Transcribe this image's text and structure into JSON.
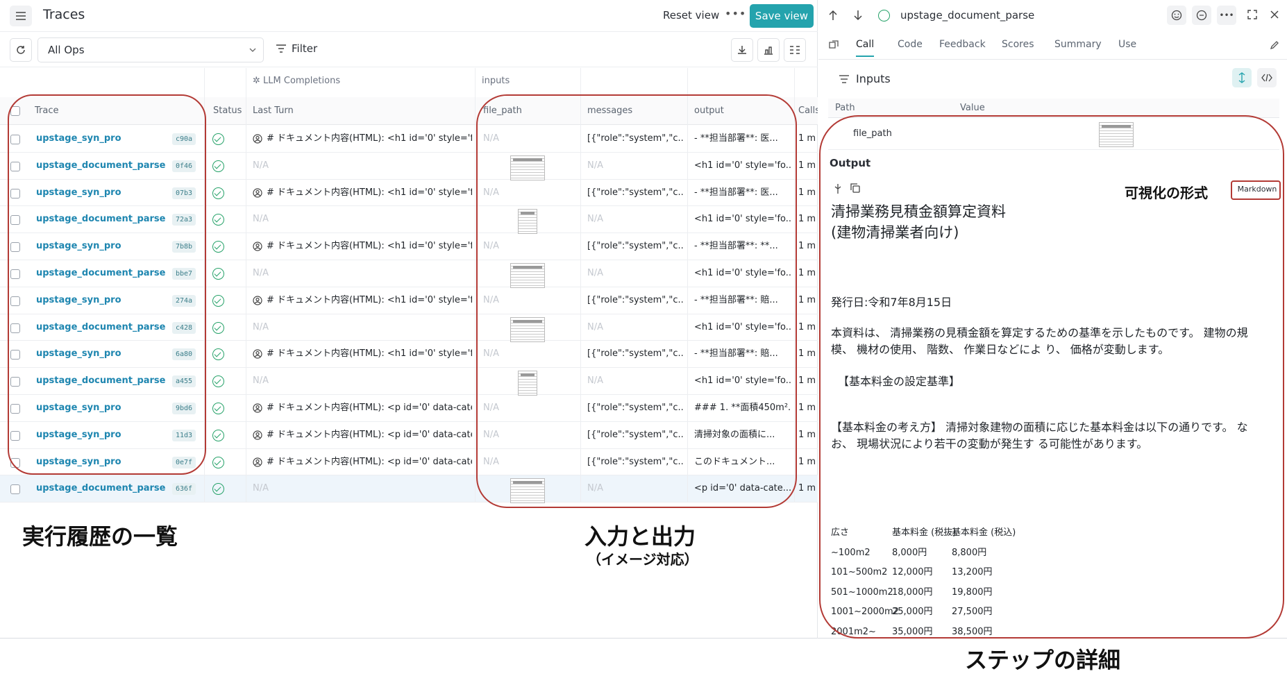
{
  "header": {
    "title": "Traces",
    "reset_view": "Reset view",
    "more": "•••",
    "save_view": "Save view"
  },
  "toolbar": {
    "ops_select": "All Ops",
    "filter": "Filter"
  },
  "table": {
    "group_llm": "LLM Completions",
    "group_inputs": "inputs",
    "columns": {
      "trace": "Trace",
      "status": "Status",
      "last_turn": "Last Turn",
      "file_path": "file_path",
      "messages": "messages",
      "output": "output",
      "calls": "Calls"
    },
    "rows": [
      {
        "name": "upstage_syn_pro",
        "id": "c90a",
        "last_turn": "# ドキュメント内容(HTML): <h1 id='0' style='fo",
        "file_path": "N/A",
        "messages": "[{\"role\":\"system\",\"c...",
        "output": "- **担当部署**: 医...",
        "calls": "1 m"
      },
      {
        "name": "upstage_document_parse",
        "id": "0f46",
        "last_turn": "N/A",
        "file_path": "",
        "messages": "N/A",
        "output": "<h1 id='0' style='fo...",
        "calls": "1 m"
      },
      {
        "name": "upstage_syn_pro",
        "id": "07b3",
        "last_turn": "# ドキュメント内容(HTML): <h1 id='0' style='fo",
        "file_path": "N/A",
        "messages": "[{\"role\":\"system\",\"c...",
        "output": "- **担当部署**: 医...",
        "calls": "1 m"
      },
      {
        "name": "upstage_document_parse",
        "id": "72a3",
        "last_turn": "N/A",
        "file_path": "",
        "messages": "N/A",
        "output": "<h1 id='0' style='fo...",
        "calls": "1 m"
      },
      {
        "name": "upstage_syn_pro",
        "id": "7b8b",
        "last_turn": "# ドキュメント内容(HTML): <h1 id='0' style='fo",
        "file_path": "N/A",
        "messages": "[{\"role\":\"system\",\"c...",
        "output": "- **担当部署**: **...",
        "calls": "1 m"
      },
      {
        "name": "upstage_document_parse",
        "id": "bbe7",
        "last_turn": "N/A",
        "file_path": "",
        "messages": "N/A",
        "output": "<h1 id='0' style='fo...",
        "calls": "1 m"
      },
      {
        "name": "upstage_syn_pro",
        "id": "274a",
        "last_turn": "# ドキュメント内容(HTML): <h1 id='0' style='fo",
        "file_path": "N/A",
        "messages": "[{\"role\":\"system\",\"c...",
        "output": "- **担当部署**: 賠...",
        "calls": "1 m"
      },
      {
        "name": "upstage_document_parse",
        "id": "c428",
        "last_turn": "N/A",
        "file_path": "",
        "messages": "N/A",
        "output": "<h1 id='0' style='fo...",
        "calls": "1 m"
      },
      {
        "name": "upstage_syn_pro",
        "id": "6a80",
        "last_turn": "# ドキュメント内容(HTML): <h1 id='0' style='fo",
        "file_path": "N/A",
        "messages": "[{\"role\":\"system\",\"c...",
        "output": "- **担当部署**: 賠...",
        "calls": "1 m"
      },
      {
        "name": "upstage_document_parse",
        "id": "a455",
        "last_turn": "N/A",
        "file_path": "",
        "messages": "N/A",
        "output": "<h1 id='0' style='fo...",
        "calls": "1 m"
      },
      {
        "name": "upstage_syn_pro",
        "id": "9bd6",
        "last_turn": "# ドキュメント内容(HTML): <p id='0' data-cate",
        "file_path": "N/A",
        "messages": "[{\"role\":\"system\",\"c...",
        "output": "### 1. **面積450m²...",
        "calls": "1 m"
      },
      {
        "name": "upstage_syn_pro",
        "id": "11d3",
        "last_turn": "# ドキュメント内容(HTML): <p id='0' data-cate",
        "file_path": "N/A",
        "messages": "[{\"role\":\"system\",\"c...",
        "output": "清掃対象の面積に...",
        "calls": "1 m"
      },
      {
        "name": "upstage_syn_pro",
        "id": "0e7f",
        "last_turn": "# ドキュメント内容(HTML): <p id='0' data-cate",
        "file_path": "N/A",
        "messages": "[{\"role\":\"system\",\"c...",
        "output": "このドキュメント...",
        "calls": "1 m"
      },
      {
        "name": "upstage_document_parse",
        "id": "636f",
        "last_turn": "N/A",
        "file_path": "",
        "messages": "N/A",
        "output": "<p id='0' data-cate...",
        "calls": "1 m"
      }
    ]
  },
  "detail": {
    "title": "upstage_document_parse",
    "tabs": [
      "Call",
      "Code",
      "Feedback",
      "Scores",
      "Summary",
      "Use"
    ],
    "inputs_label": "Inputs",
    "path_col": "Path",
    "value_col": "Value",
    "file_path_key": "file_path",
    "output_label": "Output",
    "format_badge": "Markdown",
    "doc_title_1": "清掃業務見積金額算定資料",
    "doc_title_2": "(建物清掃業者向け)",
    "issue_date": "発行日:令和7年8月15日",
    "para1": "本資料は、 清掃業務の見積金額を算定するための基準を示したものです。 建物の規模、 機材の使用、 階数、 作業日などによ り、 価格が変動します。",
    "section1": "【基本料金の設定基準】",
    "para2": "【基本料金の考え方】 清掃対象建物の面積に応じた基本料金は以下の通りです。 なお、 現場状況により若干の変動が発生す る可能性があります。",
    "price_table": {
      "headers": [
        "広さ",
        "基本料金 (税抜)",
        "基本料金 (税込)"
      ],
      "rows": [
        [
          "~100m2",
          "8,000円",
          "8,800円"
        ],
        [
          "101~500m2",
          "12,000円",
          "13,200円"
        ],
        [
          "501~1000m2",
          "18,000円",
          "19,800円"
        ],
        [
          "1001~2000m2",
          "25,000円",
          "27,500円"
        ],
        [
          "2001m2~",
          "35,000円",
          "38,500円"
        ]
      ]
    }
  },
  "annotations": {
    "history": "実行履歴の一覧",
    "io": "入力と出力",
    "io_sub": "（イメージ対応）",
    "detail": "ステップの詳細",
    "format": "可視化の形式"
  },
  "colors": {
    "accent": "#24a3ad",
    "link": "#1e86b0",
    "success": "#26a269",
    "annotation_red": "#b33a35"
  }
}
